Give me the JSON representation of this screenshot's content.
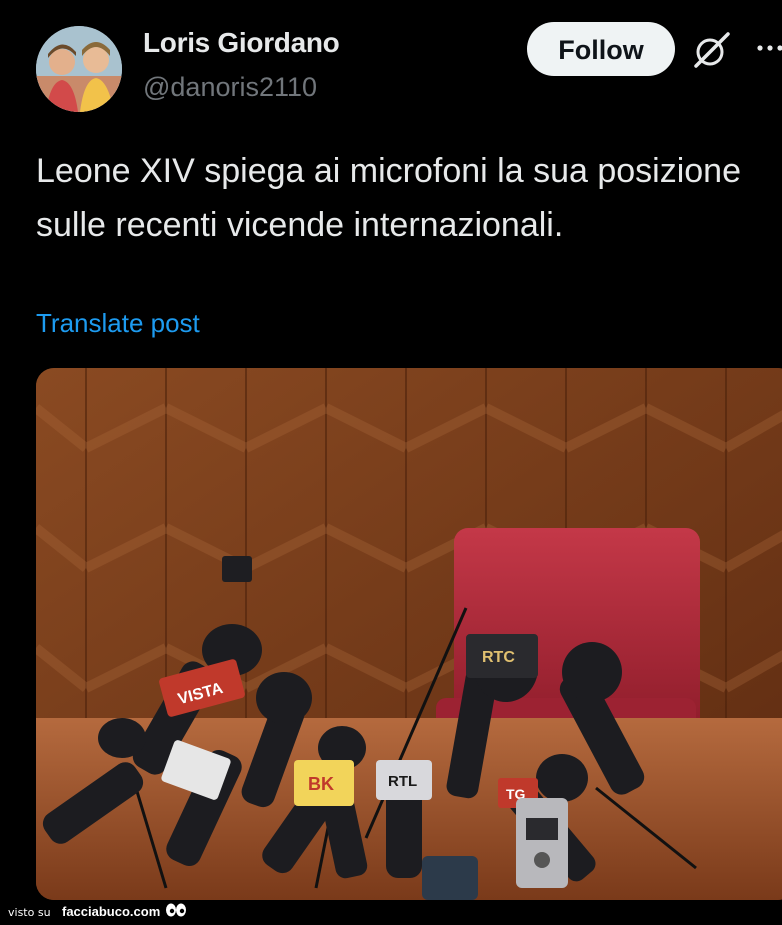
{
  "post": {
    "author": {
      "display_name": "Loris Giordano",
      "handle": "@danoris2110",
      "avatar_icon": "profile-photo"
    },
    "actions": {
      "follow_label": "Follow",
      "grok_icon": "grok-icon",
      "more_icon": "more-horizontal-icon"
    },
    "text": "Leone XIV spiega ai microfoni la sua posizione sulle recenti vicende internazionali.",
    "translate_label": "Translate post",
    "media": {
      "type": "photo",
      "microphone_flags": [
        "VISTA",
        "RTC",
        "RTL",
        "BK",
        "TG"
      ]
    }
  },
  "watermark": {
    "prefix": "visto su",
    "site": "facciabuco.com"
  },
  "colors": {
    "background": "#000000",
    "text_primary": "#e7e9ea",
    "text_secondary": "#71767b",
    "link": "#1d9bf0",
    "follow_button_bg": "#eff3f4"
  }
}
